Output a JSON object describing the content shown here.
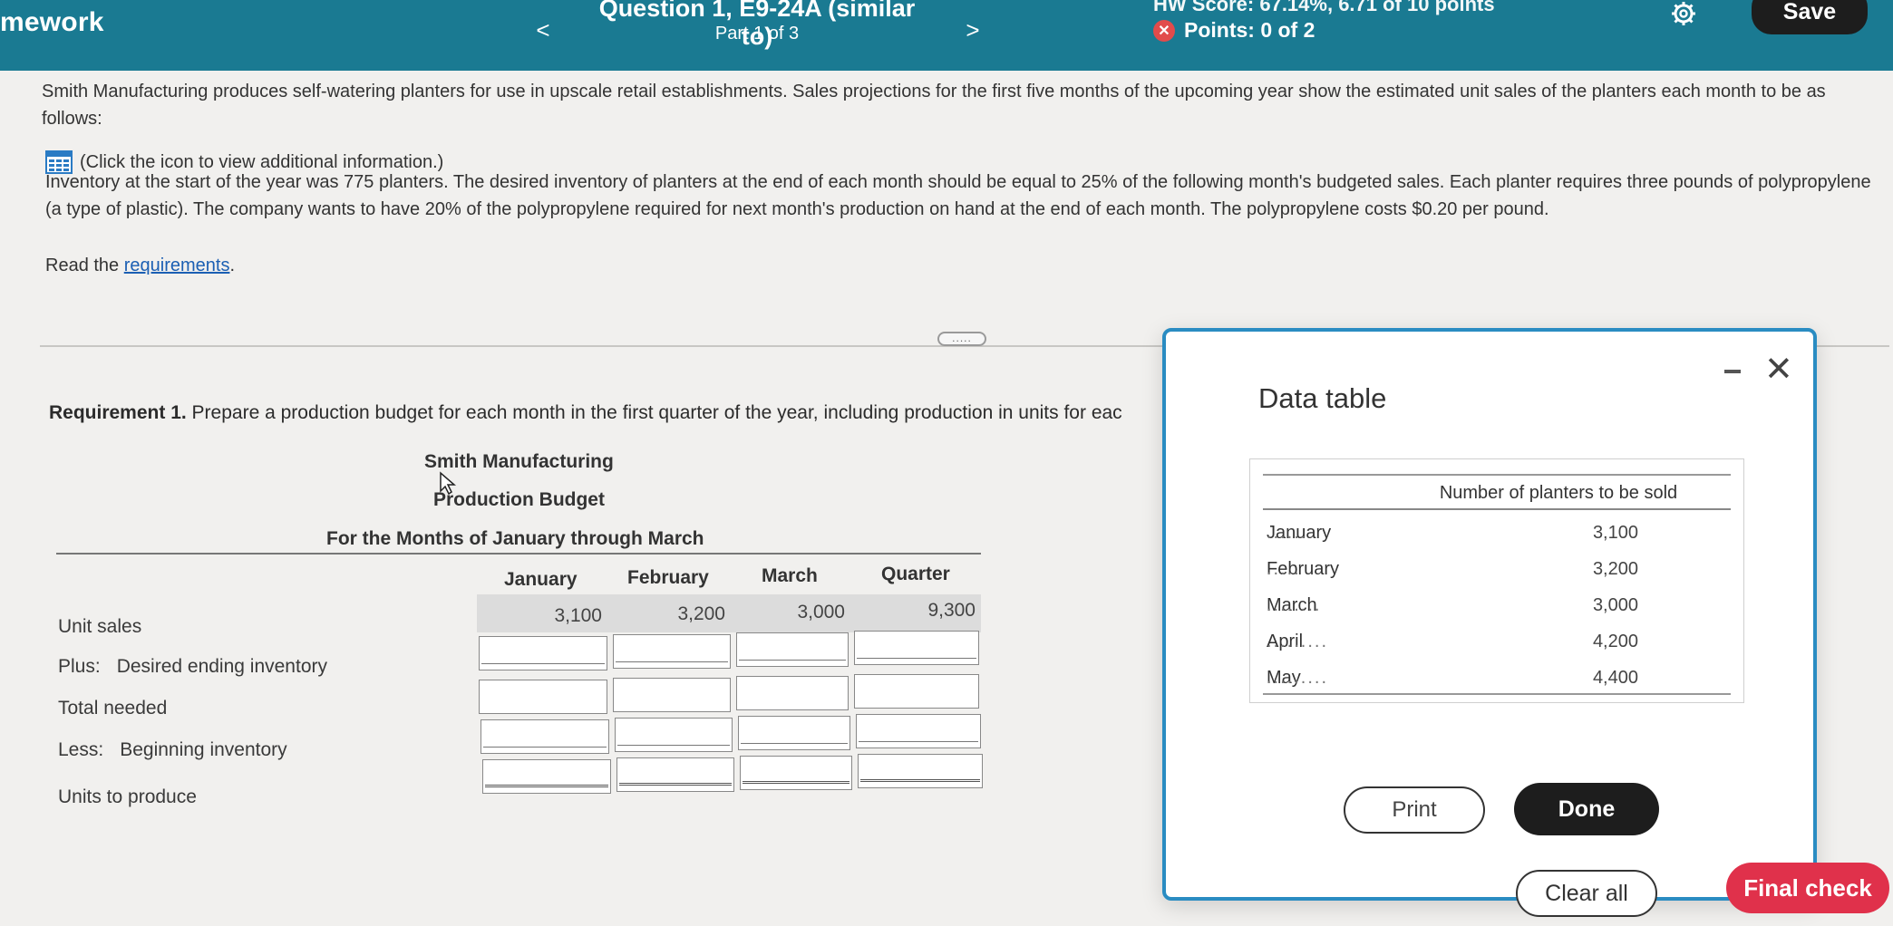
{
  "header": {
    "brand": "mework",
    "prev_label": "<",
    "next_label": ">",
    "question_title": "Question 1, E9-24A (similar to)",
    "question_part": "Part 1 of 3",
    "hw_score": "HW Score: 67.14%, 6.71 of 10 points",
    "points": "Points: 0 of 2",
    "save_label": "Save"
  },
  "problem": {
    "intro": "Smith Manufacturing produces self-watering planters for use in upscale retail establishments. Sales projections for the first five months of the upcoming year show the estimated unit sales of the planters each month to be as follows:",
    "icon_hint": "(Click the icon to view additional information.)",
    "details": "Inventory at the start of the year was 775 planters. The desired inventory of planters at the end of each month should be equal to 25% of the following month's budgeted sales. Each planter requires three pounds of polypropylene (a type of plastic). The company wants to have 20% of the polypropylene required for next month's production on hand at the end of each month. The polypropylene costs $0.20 per pound.",
    "read_prefix": "Read the ",
    "read_link": "requirements",
    "read_suffix": ".",
    "more_label": "....."
  },
  "requirement": {
    "label": "Requirement 1.",
    "text": " Prepare a production budget for each month in the first quarter of the year, including production in units for eac"
  },
  "budget": {
    "company": "Smith Manufacturing",
    "title": "Production Budget",
    "period": "For the Months of January through March",
    "columns": [
      "January",
      "February",
      "March",
      "Quarter"
    ],
    "rows": [
      {
        "prefix": "",
        "label": "Unit sales"
      },
      {
        "prefix": "Plus:",
        "label": "Desired ending inventory"
      },
      {
        "prefix": "",
        "label": "Total needed"
      },
      {
        "prefix": "Less:",
        "label": "Beginning inventory"
      },
      {
        "prefix": "",
        "label": "Units to produce"
      }
    ],
    "unit_sales": [
      "3,100",
      "3,200",
      "3,000",
      "9,300"
    ]
  },
  "data_table": {
    "title": "Data table",
    "column_header": "Number of planters to be sold",
    "rows": [
      {
        "month": "January",
        "value": "3,100"
      },
      {
        "month": "February",
        "value": "3,200"
      },
      {
        "month": "March",
        "value": "3,000"
      },
      {
        "month": "April",
        "value": "4,200"
      },
      {
        "month": "May",
        "value": "4,400"
      }
    ],
    "print_label": "Print",
    "done_label": "Done"
  },
  "footer": {
    "clear_label": "Clear all",
    "final_label": "Final check"
  },
  "colors": {
    "header_bg": "#1a7a92",
    "modal_border": "#2a8cc2",
    "final_check": "#e0314b"
  }
}
